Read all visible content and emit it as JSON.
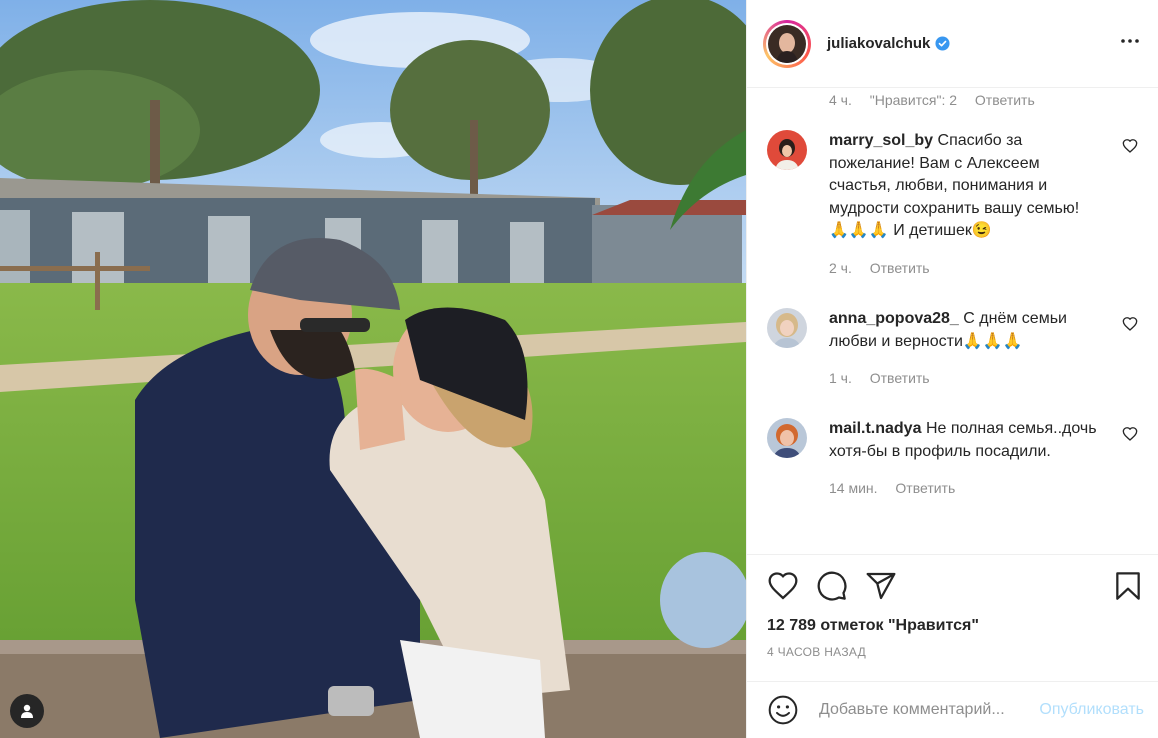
{
  "post": {
    "username": "juliakovalchuk",
    "verified": true,
    "more_icon": "more-dots-icon"
  },
  "previous_comment_meta": {
    "time": "4 ч.",
    "likes": "\"Нравится\": 2",
    "reply": "Ответить"
  },
  "comments": [
    {
      "user": "marry_sol_by",
      "text": "Спасибо за пожелание! Вам с Алексеем счастья, любви, понимания и мудрости сохранить вашу семью!🙏🙏🙏 И детишек😉",
      "time": "2 ч.",
      "reply": "Ответить"
    },
    {
      "user": "anna_popova28_",
      "text": "С днём семьи любви и верности🙏🙏🙏",
      "time": "1 ч.",
      "reply": "Ответить"
    },
    {
      "user": "mail.t.nadya",
      "text": "Не полная семья..дочь хотя-бы в профиль посадили.",
      "time": "14 мин.",
      "reply": "Ответить"
    }
  ],
  "actions": {
    "likes_text": "12 789 отметок \"Нравится\"",
    "time_ago": "4 ЧАСОВ НАЗАД"
  },
  "add_comment": {
    "placeholder": "Добавьте комментарий...",
    "publish_label": "Опубликовать"
  },
  "colors": {
    "accent": "#0095f6",
    "publish_disabled": "#b2dffc",
    "muted": "#8e8e8e",
    "text": "#262626"
  }
}
